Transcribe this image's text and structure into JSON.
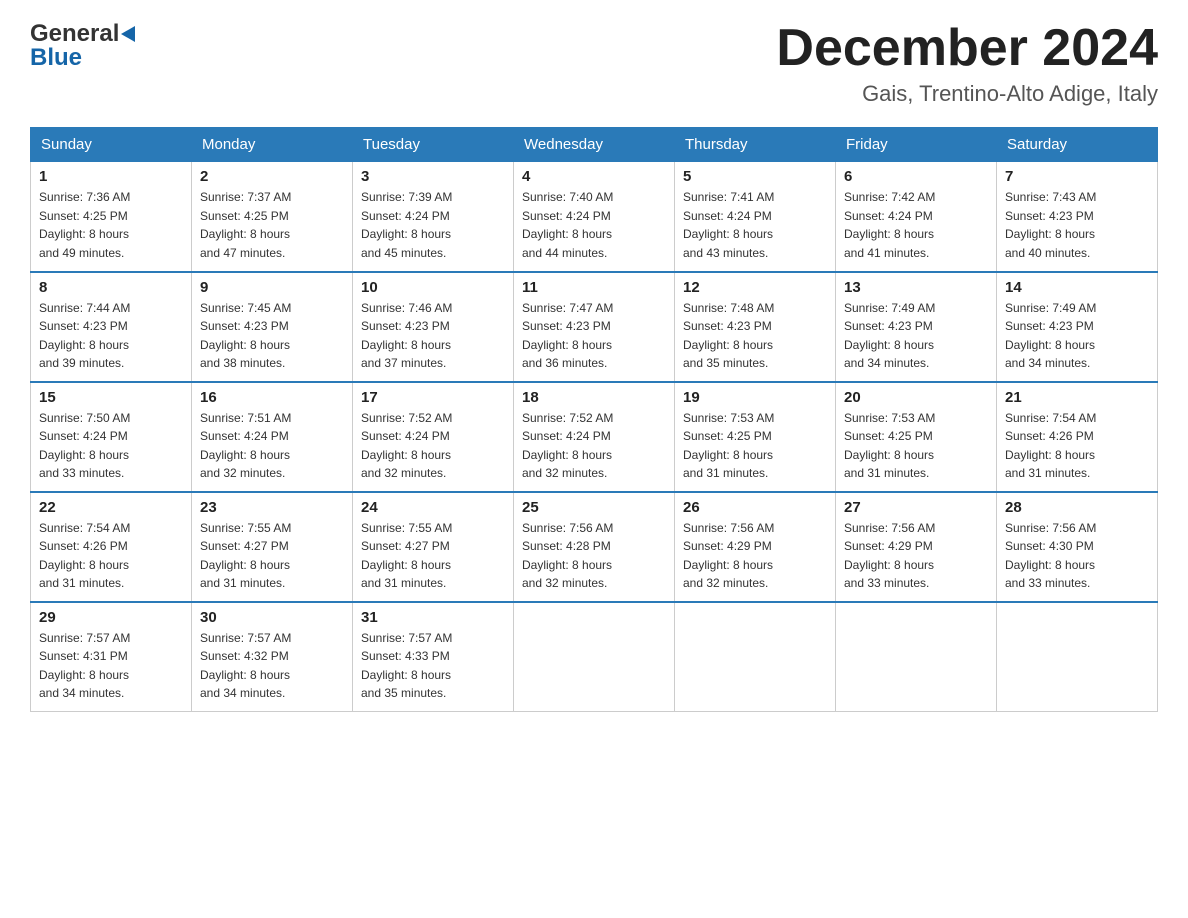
{
  "header": {
    "month_title": "December 2024",
    "location": "Gais, Trentino-Alto Adige, Italy",
    "logo_line1": "General",
    "logo_line2": "Blue"
  },
  "days_of_week": [
    "Sunday",
    "Monday",
    "Tuesday",
    "Wednesday",
    "Thursday",
    "Friday",
    "Saturday"
  ],
  "weeks": [
    [
      {
        "day": "1",
        "sunrise": "7:36 AM",
        "sunset": "4:25 PM",
        "daylight": "8 hours and 49 minutes."
      },
      {
        "day": "2",
        "sunrise": "7:37 AM",
        "sunset": "4:25 PM",
        "daylight": "8 hours and 47 minutes."
      },
      {
        "day": "3",
        "sunrise": "7:39 AM",
        "sunset": "4:24 PM",
        "daylight": "8 hours and 45 minutes."
      },
      {
        "day": "4",
        "sunrise": "7:40 AM",
        "sunset": "4:24 PM",
        "daylight": "8 hours and 44 minutes."
      },
      {
        "day": "5",
        "sunrise": "7:41 AM",
        "sunset": "4:24 PM",
        "daylight": "8 hours and 43 minutes."
      },
      {
        "day": "6",
        "sunrise": "7:42 AM",
        "sunset": "4:24 PM",
        "daylight": "8 hours and 41 minutes."
      },
      {
        "day": "7",
        "sunrise": "7:43 AM",
        "sunset": "4:23 PM",
        "daylight": "8 hours and 40 minutes."
      }
    ],
    [
      {
        "day": "8",
        "sunrise": "7:44 AM",
        "sunset": "4:23 PM",
        "daylight": "8 hours and 39 minutes."
      },
      {
        "day": "9",
        "sunrise": "7:45 AM",
        "sunset": "4:23 PM",
        "daylight": "8 hours and 38 minutes."
      },
      {
        "day": "10",
        "sunrise": "7:46 AM",
        "sunset": "4:23 PM",
        "daylight": "8 hours and 37 minutes."
      },
      {
        "day": "11",
        "sunrise": "7:47 AM",
        "sunset": "4:23 PM",
        "daylight": "8 hours and 36 minutes."
      },
      {
        "day": "12",
        "sunrise": "7:48 AM",
        "sunset": "4:23 PM",
        "daylight": "8 hours and 35 minutes."
      },
      {
        "day": "13",
        "sunrise": "7:49 AM",
        "sunset": "4:23 PM",
        "daylight": "8 hours and 34 minutes."
      },
      {
        "day": "14",
        "sunrise": "7:49 AM",
        "sunset": "4:23 PM",
        "daylight": "8 hours and 34 minutes."
      }
    ],
    [
      {
        "day": "15",
        "sunrise": "7:50 AM",
        "sunset": "4:24 PM",
        "daylight": "8 hours and 33 minutes."
      },
      {
        "day": "16",
        "sunrise": "7:51 AM",
        "sunset": "4:24 PM",
        "daylight": "8 hours and 32 minutes."
      },
      {
        "day": "17",
        "sunrise": "7:52 AM",
        "sunset": "4:24 PM",
        "daylight": "8 hours and 32 minutes."
      },
      {
        "day": "18",
        "sunrise": "7:52 AM",
        "sunset": "4:24 PM",
        "daylight": "8 hours and 32 minutes."
      },
      {
        "day": "19",
        "sunrise": "7:53 AM",
        "sunset": "4:25 PM",
        "daylight": "8 hours and 31 minutes."
      },
      {
        "day": "20",
        "sunrise": "7:53 AM",
        "sunset": "4:25 PM",
        "daylight": "8 hours and 31 minutes."
      },
      {
        "day": "21",
        "sunrise": "7:54 AM",
        "sunset": "4:26 PM",
        "daylight": "8 hours and 31 minutes."
      }
    ],
    [
      {
        "day": "22",
        "sunrise": "7:54 AM",
        "sunset": "4:26 PM",
        "daylight": "8 hours and 31 minutes."
      },
      {
        "day": "23",
        "sunrise": "7:55 AM",
        "sunset": "4:27 PM",
        "daylight": "8 hours and 31 minutes."
      },
      {
        "day": "24",
        "sunrise": "7:55 AM",
        "sunset": "4:27 PM",
        "daylight": "8 hours and 31 minutes."
      },
      {
        "day": "25",
        "sunrise": "7:56 AM",
        "sunset": "4:28 PM",
        "daylight": "8 hours and 32 minutes."
      },
      {
        "day": "26",
        "sunrise": "7:56 AM",
        "sunset": "4:29 PM",
        "daylight": "8 hours and 32 minutes."
      },
      {
        "day": "27",
        "sunrise": "7:56 AM",
        "sunset": "4:29 PM",
        "daylight": "8 hours and 33 minutes."
      },
      {
        "day": "28",
        "sunrise": "7:56 AM",
        "sunset": "4:30 PM",
        "daylight": "8 hours and 33 minutes."
      }
    ],
    [
      {
        "day": "29",
        "sunrise": "7:57 AM",
        "sunset": "4:31 PM",
        "daylight": "8 hours and 34 minutes."
      },
      {
        "day": "30",
        "sunrise": "7:57 AM",
        "sunset": "4:32 PM",
        "daylight": "8 hours and 34 minutes."
      },
      {
        "day": "31",
        "sunrise": "7:57 AM",
        "sunset": "4:33 PM",
        "daylight": "8 hours and 35 minutes."
      },
      null,
      null,
      null,
      null
    ]
  ],
  "sunrise_label": "Sunrise:",
  "sunset_label": "Sunset:",
  "daylight_label": "Daylight:"
}
